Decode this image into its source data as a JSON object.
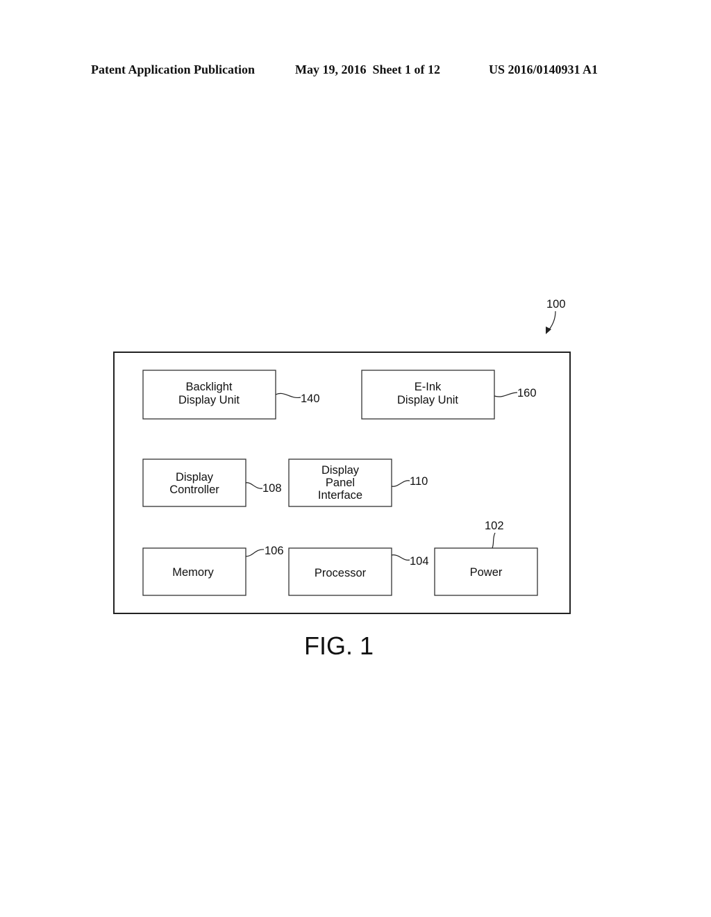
{
  "header": {
    "publication": "Patent Application Publication",
    "date_sheet": "May 19, 2016  Sheet 1 of 12",
    "number": "US 2016/0140931 A1"
  },
  "figure": {
    "caption": "FIG. 1",
    "system_ref": "100",
    "blocks": [
      {
        "id": "backlight",
        "lines": [
          "Backlight",
          "Display Unit"
        ],
        "ref": "140"
      },
      {
        "id": "eink",
        "lines": [
          "E-Ink",
          "Display Unit"
        ],
        "ref": "160"
      },
      {
        "id": "display-controller",
        "lines": [
          "Display",
          "Controller"
        ],
        "ref": "108"
      },
      {
        "id": "display-panel-interface",
        "lines": [
          "Display",
          "Panel",
          "Interface"
        ],
        "ref": "110"
      },
      {
        "id": "memory",
        "lines": [
          "Memory"
        ],
        "ref": "106"
      },
      {
        "id": "processor",
        "lines": [
          "Processor"
        ],
        "ref": "104"
      },
      {
        "id": "power",
        "lines": [
          "Power"
        ],
        "ref": "102"
      }
    ]
  }
}
